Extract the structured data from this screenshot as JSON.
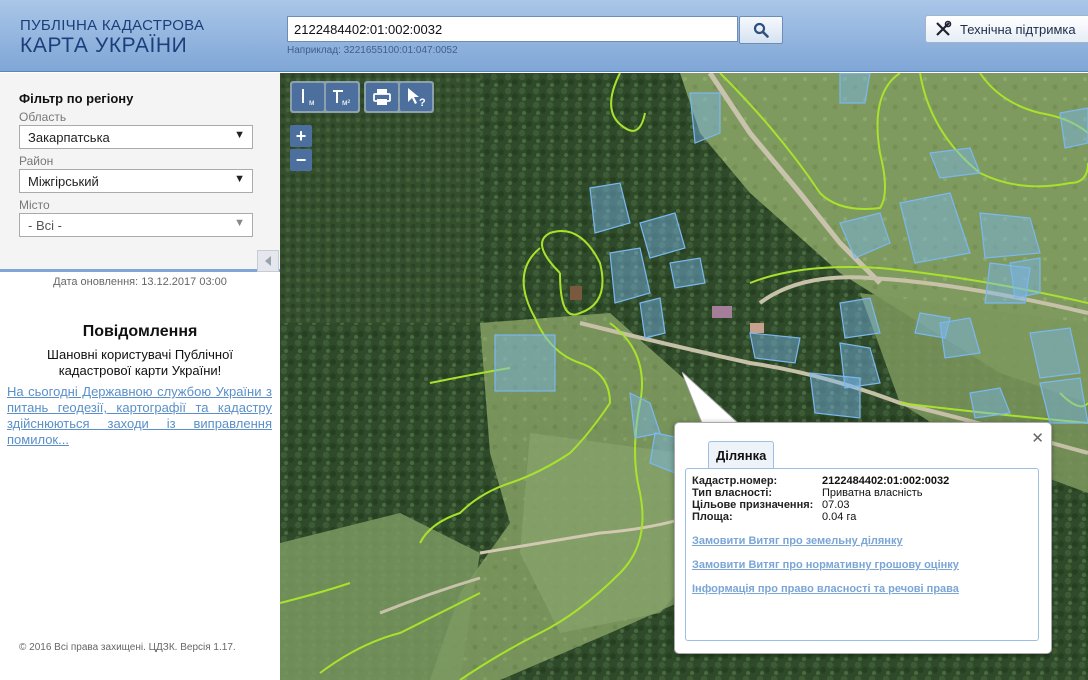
{
  "header": {
    "logo_line1": "ПУБЛІЧНА КАДАСТРОВА",
    "logo_line2": "КАРТА УКРАЇНИ",
    "search_value": "2122484402:01:002:0032",
    "search_example": "Наприклад: 3221655100:01:047:0052",
    "support_label": "Технічна підтримка"
  },
  "sidebar": {
    "filter_title": "Фільтр по регіону",
    "oblast_label": "Область",
    "oblast_value": "Закарпатська",
    "rayon_label": "Район",
    "rayon_value": "Міжгірський",
    "city_label": "Місто",
    "city_value": "- Всі -",
    "update_date": "Дата оновлення: 13.12.2017 03:00",
    "notice_title": "Повідомлення",
    "notice_text": "Шановні користувачі Публічної кадастрової карти України!",
    "notice_link": "На сьогодні Державною службою України з питань геодезії, картографії та кадастру здійснюються заходи із виправлення помилок...",
    "copyright": "© 2016 Всі права захищені. ЦДЗК. Версія 1.17."
  },
  "map": {
    "tools": [
      "measure-length",
      "measure-area",
      "print",
      "identify"
    ],
    "zoom_in": "+",
    "zoom_out": "−"
  },
  "popup": {
    "tab": "Ділянка",
    "cadastral_label": "Кадастр.номер:",
    "cadastral_value": "2122484402:01:002:0032",
    "ownership_label": "Тип власності:",
    "ownership_value": "Приватна власність",
    "purpose_label": "Цільове призначення:",
    "purpose_value": "07.03",
    "area_label": "Площа:",
    "area_value": "0.04 га",
    "link1": "Замовити Витяг про земельну ділянку",
    "link2": "Замовити Витяг про нормативну грошову оцінку",
    "link3": "Інформація про право власності та речові права",
    "close": "✕"
  },
  "colors": {
    "header_blue": "#7fa6d6",
    "boundary_green": "#a8e22c",
    "parcel_blue": "#7ab8f0",
    "link_blue": "#5b8fc9"
  }
}
